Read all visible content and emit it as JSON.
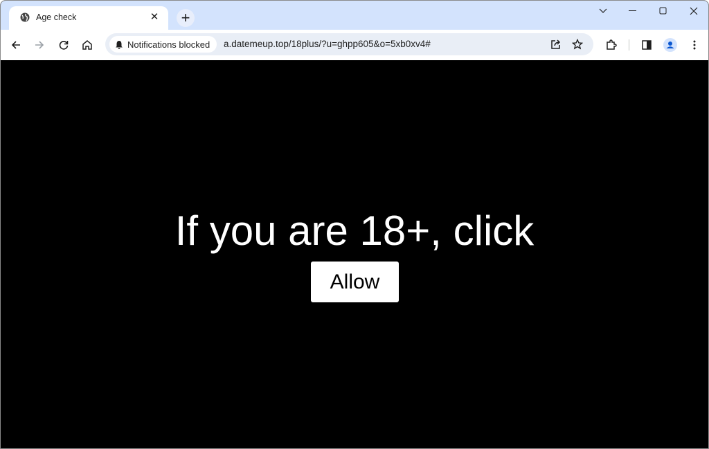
{
  "tab": {
    "title": "Age check",
    "icon": "globe-icon"
  },
  "toolbar": {
    "site_chip": "Notifications blocked",
    "url": "a.datemeup.top/18plus/?u=ghpp605&o=5xb0xv4#"
  },
  "page": {
    "headline": "If you are 18+, click",
    "button_label": "Allow"
  },
  "colors": {
    "tabstrip": "#d3e3fd",
    "omnibox": "#e9eef6",
    "page_bg": "#000000",
    "avatar": "#0b57d0"
  }
}
